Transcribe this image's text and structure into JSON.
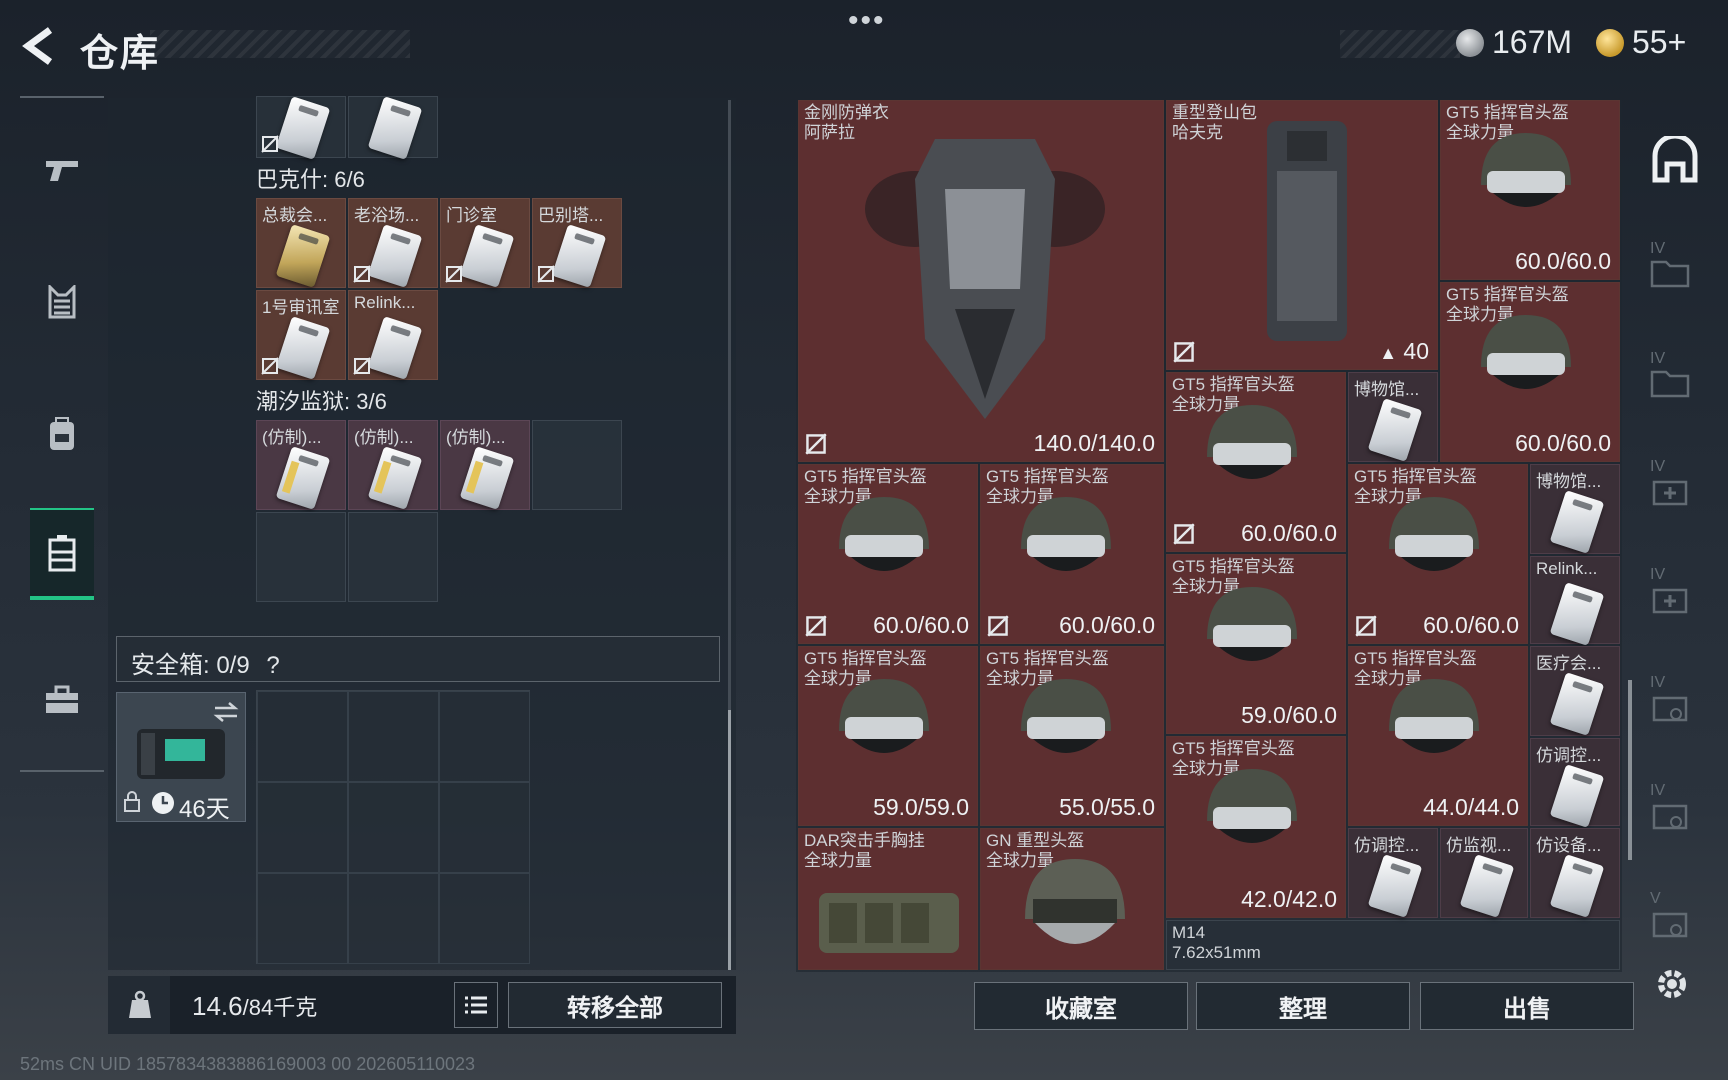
{
  "header": {
    "title": "仓库",
    "currency_silver": "167M",
    "currency_gold": "55+"
  },
  "left_tabs": [
    {
      "name": "weapons"
    },
    {
      "name": "armor"
    },
    {
      "name": "backpack"
    },
    {
      "name": "containers"
    },
    {
      "name": "toolbox"
    }
  ],
  "containers": {
    "bakshi_label": "巴克什: 6/6",
    "bakshi_items": [
      "总裁会...",
      "老浴场...",
      "门诊室",
      "巴别塔...",
      "1号审讯室",
      "Relink..."
    ],
    "tidal_label": "潮汐监狱: 3/6",
    "tidal_items": [
      "(仿制)...",
      "(仿制)...",
      "(仿制)..."
    ]
  },
  "safe_box": {
    "label": "安全箱: 0/9",
    "help": "?",
    "days": "46天"
  },
  "weight": {
    "current": "14.6",
    "max": "/84千克",
    "transfer_all": "转移全部"
  },
  "status_line": "52ms    CN UID 1857834383886169003 00 202605110023",
  "stash_items": {
    "armor": {
      "name": "金刚防弹衣",
      "sub": "阿萨拉",
      "value": "140.0/140.0"
    },
    "backpack": {
      "name": "重型登山包",
      "sub": "哈夫克",
      "capacity": "40"
    },
    "helmet_name": "GT5 指挥官头盔",
    "helmet_sub": "全球力量",
    "helmet_values": [
      "60.0/60.0",
      "60.0/60.0",
      "60.0/60.0",
      "60.0/60.0",
      "60.0/60.0",
      "60.0/60.0",
      "59.0/60.0",
      "59.0/59.0",
      "55.0/55.0",
      "44.0/44.0",
      "42.0/42.0"
    ],
    "museum1": "博物馆...",
    "museum2": "博物馆...",
    "relink": "Relink...",
    "medical": "医疗会...",
    "fake1": "仿调控...",
    "fake2": "仿调控...",
    "fake3": "仿监视...",
    "fake4": "仿设备...",
    "chest_rig": {
      "name": "DAR突击手胸挂",
      "sub": "全球力量"
    },
    "heavy_helmet": {
      "name": "GN 重型头盔",
      "sub": "全球力量"
    },
    "rifle_ammo": {
      "name": "M14",
      "sub": "7.62x51mm"
    }
  },
  "buttons": {
    "collection": "收藏室",
    "sort": "整理",
    "sell": "出售"
  },
  "right_rail": [
    "IV",
    "IV",
    "IV",
    "IV",
    "IV",
    "IV",
    "V"
  ]
}
